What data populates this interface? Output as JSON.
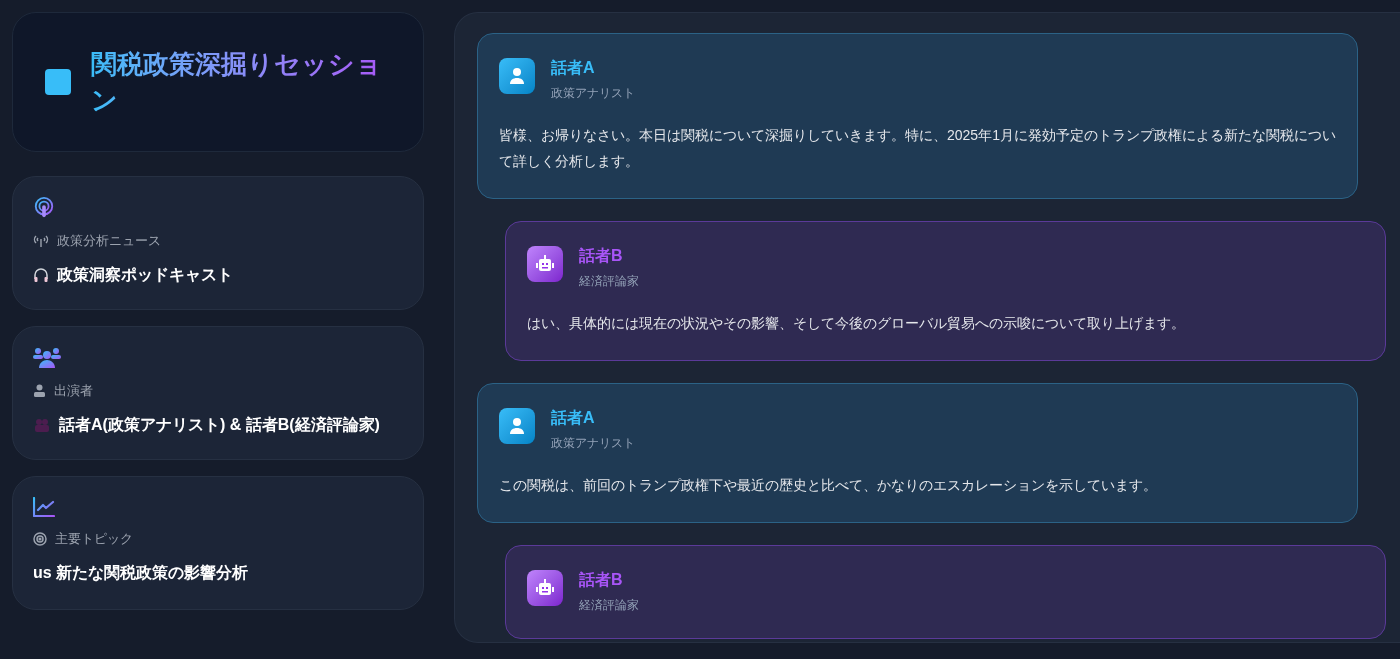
{
  "header": {
    "title": "関税政策深掘りセッション"
  },
  "info_cards": [
    {
      "kind": "podcast",
      "label": "政策分析ニュース",
      "value": "政策洞察ポッドキャスト"
    },
    {
      "kind": "people",
      "label": "出演者",
      "value": "話者A(政策アナリスト) & 話者B(経済評論家)"
    },
    {
      "kind": "topic",
      "label": "主要トピック",
      "value": "us 新たな関税政策の影響分析"
    }
  ],
  "messages": [
    {
      "kind": "a",
      "speaker": "話者A",
      "role": "政策アナリスト",
      "text": "皆様、お帰りなさい。本日は関税について深掘りしていきます。特に、2025年1月に発効予定のトランプ政権による新たな関税について詳しく分析します。"
    },
    {
      "kind": "b",
      "speaker": "話者B",
      "role": "経済評論家",
      "text": "はい、具体的には現在の状況やその影響、そして今後のグローバル貿易への示唆について取り上げます。"
    },
    {
      "kind": "a",
      "speaker": "話者A",
      "role": "政策アナリスト",
      "text": "この関税は、前回のトランプ政権下や最近の歴史と比べて、かなりのエスカレーションを示しています。"
    },
    {
      "kind": "b",
      "speaker": "話者B",
      "role": "経済評論家"
    }
  ]
}
